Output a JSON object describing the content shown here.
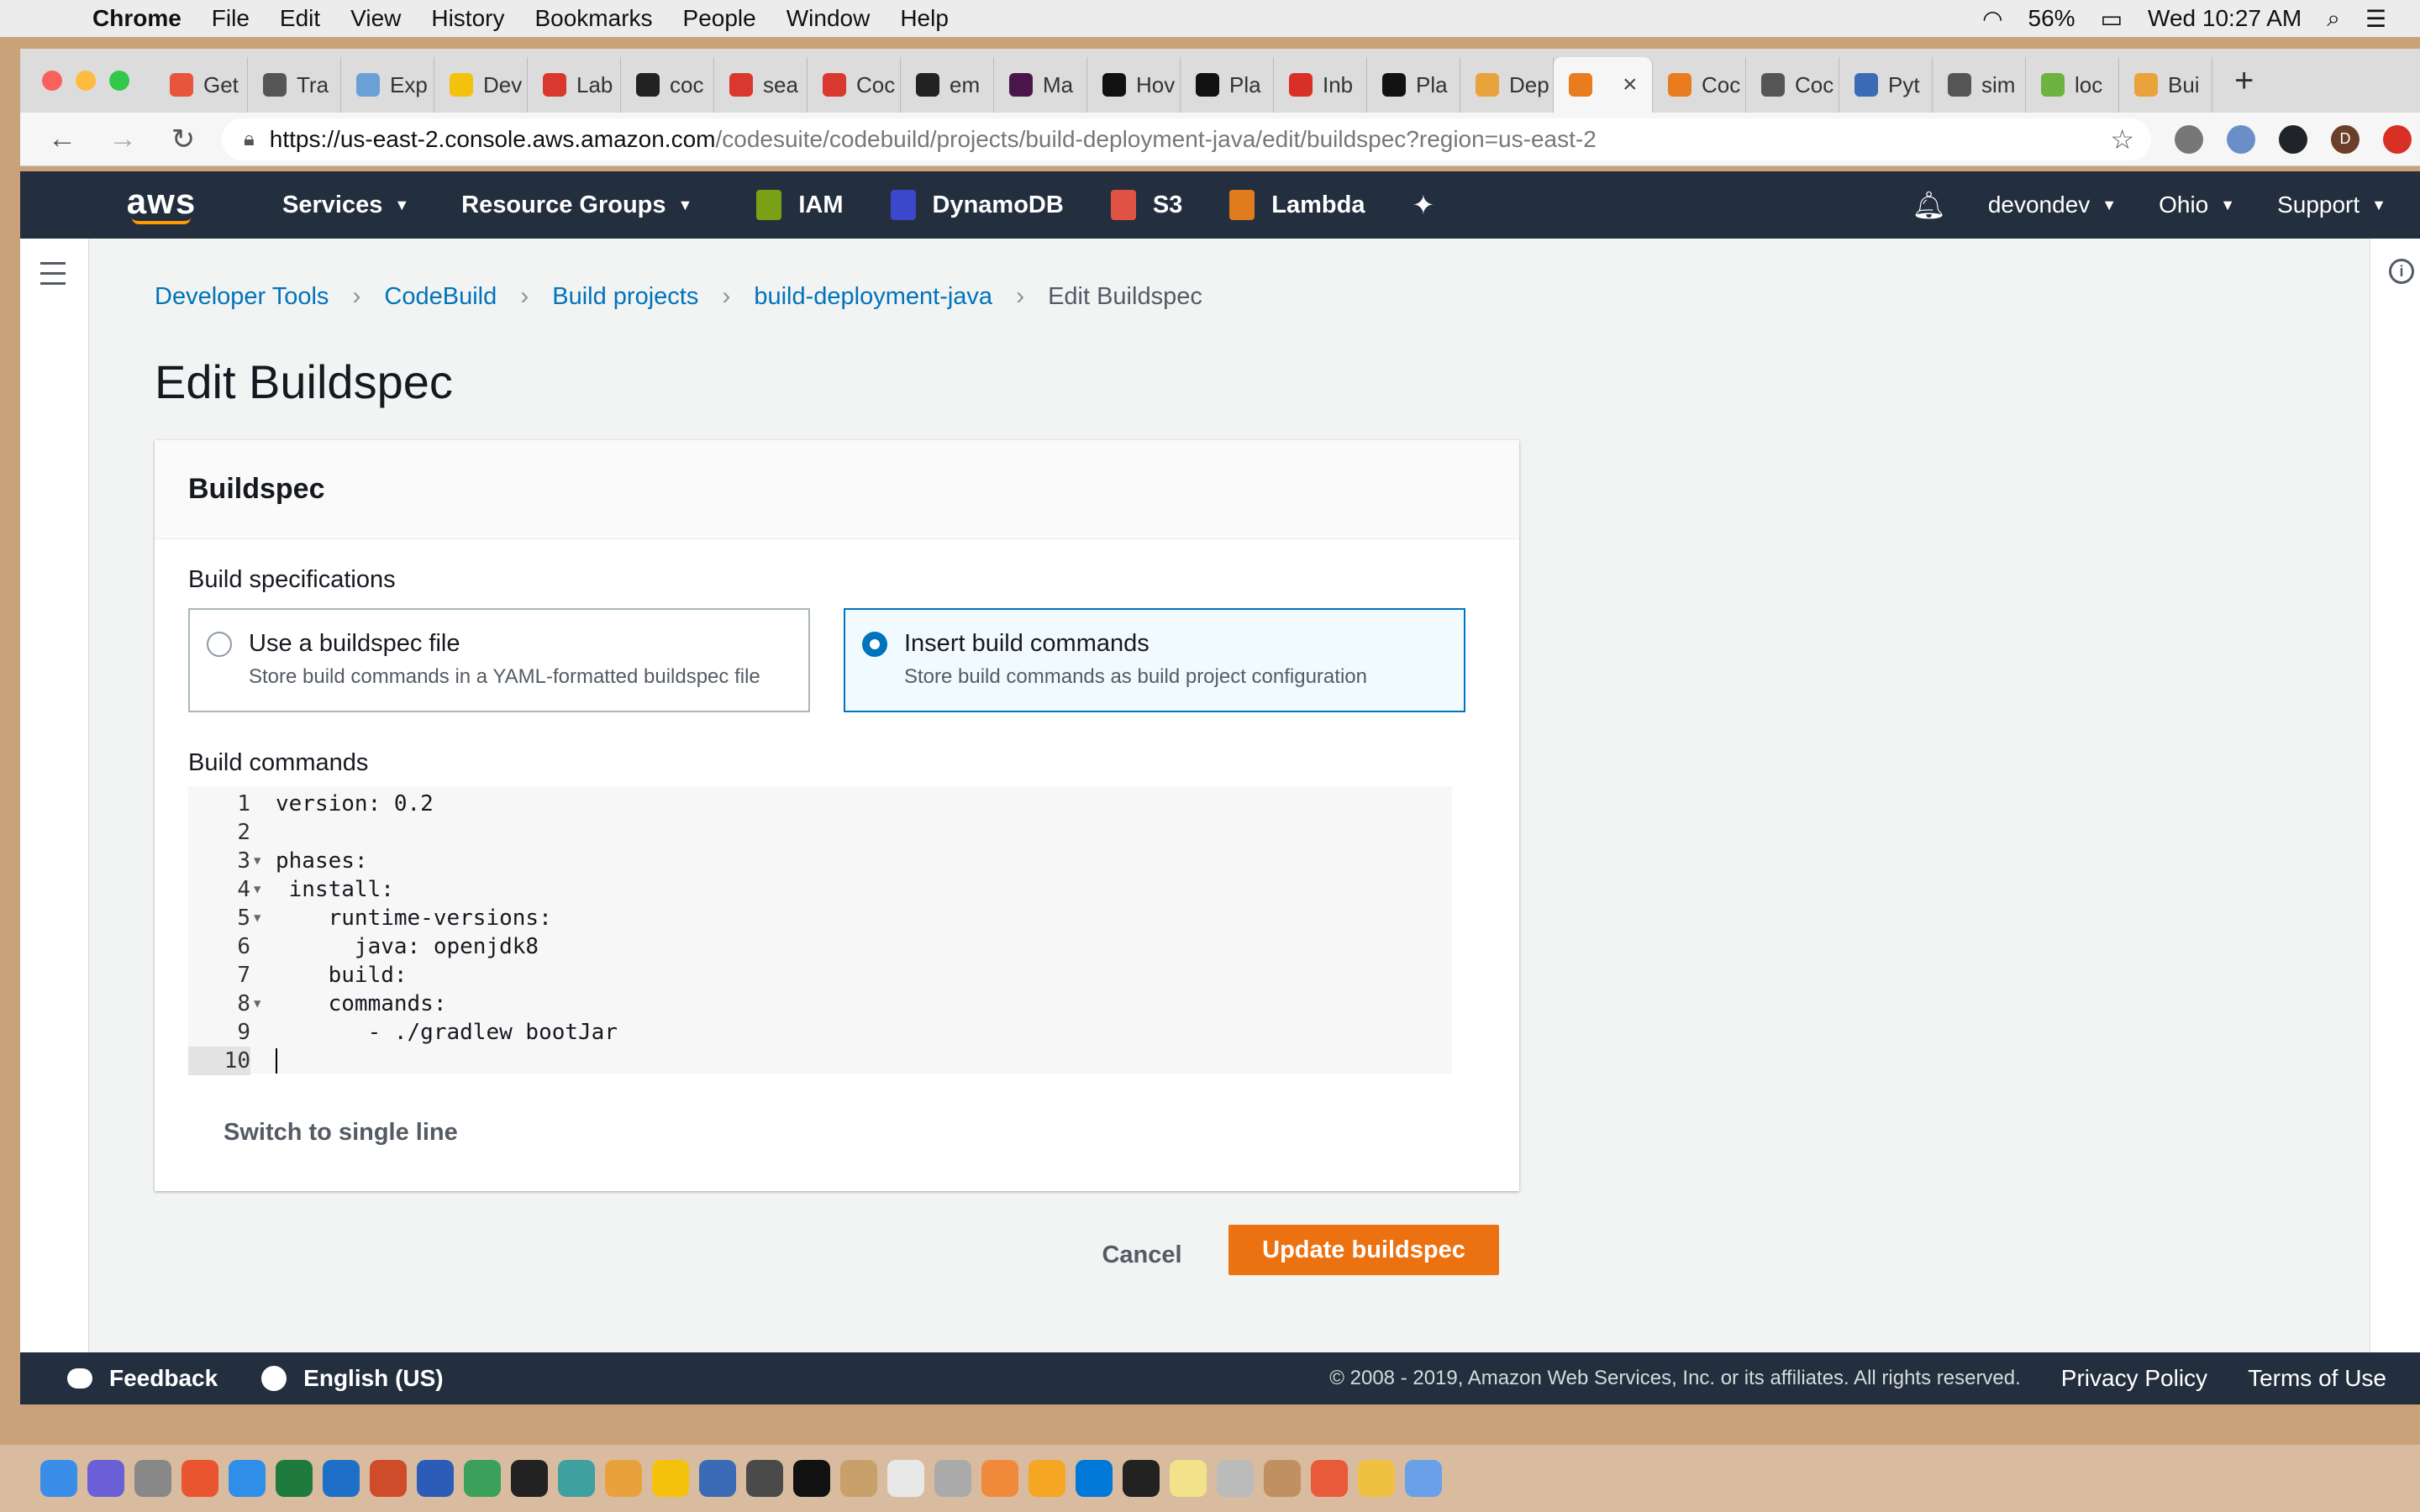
{
  "menubar": {
    "app": "Chrome",
    "items": [
      "File",
      "Edit",
      "View",
      "History",
      "Bookmarks",
      "People",
      "Window",
      "Help"
    ],
    "battery": "56%",
    "clock": "Wed 10:27 AM"
  },
  "tabs": [
    {
      "label": "Get",
      "color": "#e8553e"
    },
    {
      "label": "Tra",
      "color": "#555555"
    },
    {
      "label": "Exp",
      "color": "#6aa0d8"
    },
    {
      "label": "Dev",
      "color": "#f4c20d"
    },
    {
      "label": "Lab",
      "color": "#d8382e"
    },
    {
      "label": "coc",
      "color": "#222222"
    },
    {
      "label": "sea",
      "color": "#d8382e"
    },
    {
      "label": "Coc",
      "color": "#d8382e"
    },
    {
      "label": "em",
      "color": "#222222"
    },
    {
      "label": "Ma",
      "color": "#4a154b"
    },
    {
      "label": "Hov",
      "color": "#111111"
    },
    {
      "label": "Pla",
      "color": "#111111"
    },
    {
      "label": "Inb",
      "color": "#d93025"
    },
    {
      "label": "Pla",
      "color": "#111111"
    },
    {
      "label": "Dep",
      "color": "#e8a33c"
    },
    {
      "label": "",
      "color": "#e87c1e",
      "active": true
    },
    {
      "label": "Coc",
      "color": "#e87c1e"
    },
    {
      "label": "Coc",
      "color": "#555555"
    },
    {
      "label": "Pyt",
      "color": "#3b6bb5"
    },
    {
      "label": "sim",
      "color": "#555555"
    },
    {
      "label": "loc",
      "color": "#6db33f"
    },
    {
      "label": "Bui",
      "color": "#e8a33c"
    }
  ],
  "address": {
    "host": "https://us-east-2.console.aws.amazon.com",
    "path": "/codesuite/codebuild/projects/build-deployment-java/edit/buildspec?region=us-east-2"
  },
  "aws_nav": {
    "services": "Services",
    "resource_groups": "Resource Groups",
    "pinned": [
      {
        "label": "IAM",
        "color": "#7aa116"
      },
      {
        "label": "DynamoDB",
        "color": "#3b48cc"
      },
      {
        "label": "S3",
        "color": "#e05243"
      },
      {
        "label": "Lambda",
        "color": "#e07b1e"
      }
    ],
    "account": "devondev",
    "region": "Ohio",
    "support": "Support"
  },
  "breadcrumb": {
    "items": [
      "Developer Tools",
      "CodeBuild",
      "Build projects",
      "build-deployment-java"
    ],
    "current": "Edit Buildspec"
  },
  "page_title": "Edit Buildspec",
  "buildspec": {
    "heading": "Buildspec",
    "spec_label": "Build specifications",
    "options": [
      {
        "title": "Use a buildspec file",
        "desc": "Store build commands in a YAML-formatted buildspec file",
        "selected": false
      },
      {
        "title": "Insert build commands",
        "desc": "Store build commands as build project configuration",
        "selected": true
      }
    ],
    "commands_label": "Build commands",
    "code_lines": [
      {
        "n": "1",
        "text": "version: 0.2",
        "fold": false
      },
      {
        "n": "2",
        "text": "",
        "fold": false
      },
      {
        "n": "3",
        "text": "phases:",
        "fold": true
      },
      {
        "n": "4",
        "text": " install:",
        "fold": true
      },
      {
        "n": "5",
        "text": "    runtime-versions:",
        "fold": true
      },
      {
        "n": "6",
        "text": "      java: openjdk8",
        "fold": false
      },
      {
        "n": "7",
        "text": "    build:",
        "fold": false
      },
      {
        "n": "8",
        "text": "    commands:",
        "fold": true
      },
      {
        "n": "9",
        "text": "       - ./gradlew bootJar",
        "fold": false
      },
      {
        "n": "10",
        "text": "",
        "fold": false,
        "current": true
      }
    ],
    "switch_link": "Switch to single line"
  },
  "actions": {
    "cancel": "Cancel",
    "update": "Update buildspec"
  },
  "footer": {
    "feedback": "Feedback",
    "language": "English (US)",
    "copyright": "© 2008 - 2019, Amazon Web Services, Inc. or its affiliates. All rights reserved.",
    "privacy": "Privacy Policy",
    "terms": "Terms of Use"
  },
  "colors": {
    "aws_nav": "#232f3e",
    "primary_button": "#ec7211",
    "link": "#0073bb"
  }
}
